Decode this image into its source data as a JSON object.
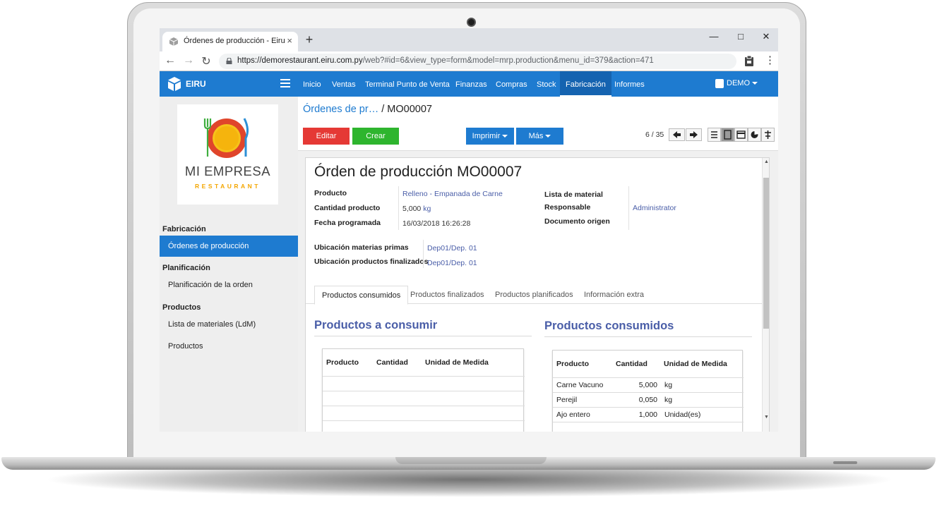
{
  "browser": {
    "tab_title": "Órdenes de producción - Eiru",
    "tab_close": "×",
    "new_tab": "+",
    "win_min": "—",
    "win_max": "□",
    "win_close": "✕",
    "url_domain": "https://demorestaurant.eiru.com.py",
    "url_rest": "/web?#id=6&view_type=form&model=mrp.production&menu_id=379&action=471"
  },
  "navbar": {
    "brand": "EIRU",
    "menu": [
      "Inicio",
      "Ventas",
      "Terminal Punto de Venta",
      "Finanzas",
      "Compras",
      "Stock",
      "Fabricación",
      "Informes"
    ],
    "active_menu": "Fabricación",
    "user": "DEMO",
    "accent_color": "#1e7bd0"
  },
  "sidebar": {
    "logo_name": "MI EMPRESA",
    "logo_sub": "RESTAURANT",
    "sections": [
      {
        "title": "Fabricación",
        "items": [
          "Órdenes de producción"
        ]
      },
      {
        "title": "Planificación",
        "items": [
          "Planificación de la orden"
        ]
      },
      {
        "title": "Productos",
        "items": [
          "Lista de materiales (LdM)",
          "Productos"
        ]
      }
    ]
  },
  "control": {
    "breadcrumb_link": "Órdenes de pr…",
    "breadcrumb_sep": "/",
    "breadcrumb_current": "MO00007",
    "edit_label": "Editar",
    "create_label": "Crear",
    "print_label": "Imprimir",
    "more_label": "Más",
    "pager": "6 / 35",
    "views": [
      "list-view-icon",
      "form-view-icon",
      "calendar-view-icon",
      "graph-view-icon",
      "gantt-view-icon"
    ]
  },
  "form": {
    "title": "Órden de producción MO00007",
    "fields": {
      "producto_label": "Producto",
      "producto_value": "Relleno - Empanada de Carne",
      "cantidad_label": "Cantidad producto",
      "cantidad_value": "5,000",
      "cantidad_uom": "kg",
      "fecha_label": "Fecha programada",
      "fecha_value": "16/03/2018 16:26:28",
      "lista_label": "Lista de material",
      "lista_value": "",
      "responsable_label": "Responsable",
      "responsable_value": "Administrator",
      "documento_label": "Documento origen",
      "documento_value": "",
      "ubic_mp_label": "Ubicación materias primas",
      "ubic_mp_value": "Dep01/Dep. 01",
      "ubic_pf_label": "Ubicación productos finalizados",
      "ubic_pf_value": "Dep01/Dep. 01"
    },
    "tabs": [
      "Productos consumidos",
      "Productos finalizados",
      "Productos planificados",
      "Información extra"
    ],
    "active_tab": "Productos consumidos",
    "to_consume": {
      "title": "Productos a consumir",
      "columns": [
        "Producto",
        "Cantidad",
        "Unidad de Medida"
      ],
      "rows": []
    },
    "consumed": {
      "title": "Productos consumidos",
      "columns": [
        "Producto",
        "Cantidad",
        "Unidad de Medida"
      ],
      "rows": [
        {
          "producto": "Carne Vacuno",
          "cantidad": "5,000",
          "uom": "kg"
        },
        {
          "producto": "Perejil",
          "cantidad": "0,050",
          "uom": "kg"
        },
        {
          "producto": "Ajo entero",
          "cantidad": "1,000",
          "uom": "Unidad(es)"
        }
      ]
    }
  }
}
